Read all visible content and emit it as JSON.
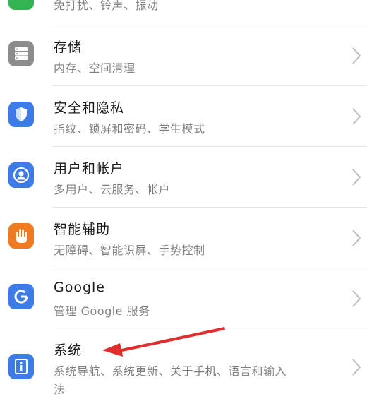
{
  "settings": {
    "top_partial": {
      "subtitle": "免打扰、铃声、振动",
      "icon": "sound-icon",
      "color": "#35b350"
    },
    "items": [
      {
        "title": "存储",
        "subtitle": "内存、空间清理",
        "icon": "storage-icon",
        "color": "#8c8c8c"
      },
      {
        "title": "安全和隐私",
        "subtitle": "指纹、锁屏和密码、学生模式",
        "icon": "shield-icon",
        "color": "#3d7be6"
      },
      {
        "title": "用户和帐户",
        "subtitle": "多用户、云服务、帐户",
        "icon": "user-icon",
        "color": "#3d7be6"
      },
      {
        "title": "智能辅助",
        "subtitle": "无障碍、智能识屏、手势控制",
        "icon": "hand-icon",
        "color": "#f07a22"
      },
      {
        "title": "Google",
        "subtitle": "管理 Google 服务",
        "icon": "google-icon",
        "color": "#3d7be6"
      },
      {
        "title": "系统",
        "subtitle": "系统导航、系统更新、关于手机、语言和输入",
        "subtitle_cont": "法",
        "icon": "system-info-icon",
        "color": "#3d7be6"
      }
    ]
  },
  "annotation": {
    "arrow_color": "#e02d2d"
  }
}
